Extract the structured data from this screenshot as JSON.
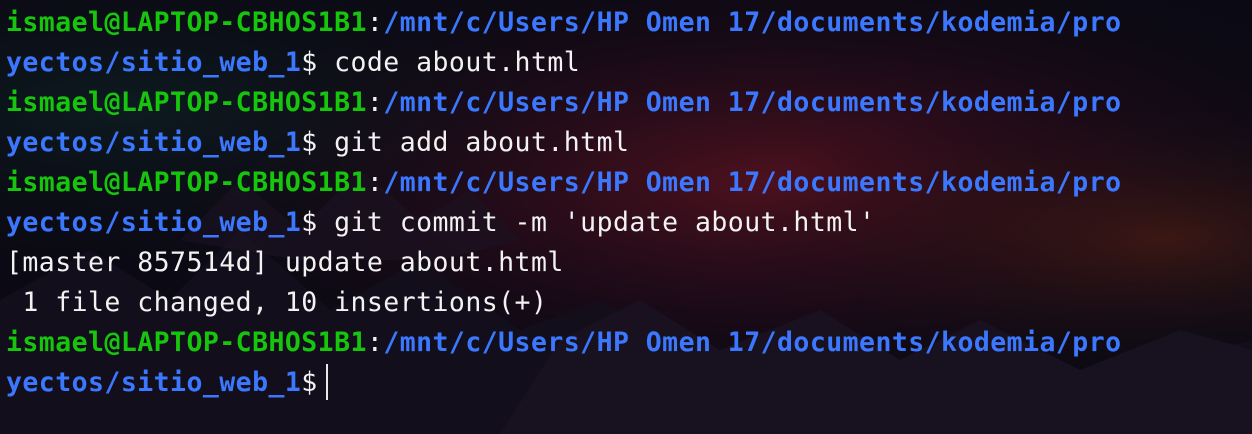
{
  "theme": {
    "background": "#0b0a14",
    "user_host_color": "#16c60c",
    "path_color": "#3b78ff",
    "text_color": "#f2f2f2"
  },
  "prompt": {
    "user_host": "ismael@LAPTOP-CBHOS1B1",
    "separator": ":",
    "path_part1": "/mnt/c/Users/HP Omen 17/documents/kodemia/pro",
    "path_part2": "yectos/sitio_web_1",
    "symbol": "$"
  },
  "session": [
    {
      "type": "command",
      "text": "code about.html"
    },
    {
      "type": "command",
      "text": "git add about.html"
    },
    {
      "type": "command",
      "text": "git commit -m 'update about.html'"
    },
    {
      "type": "output",
      "text": "[master 857514d] update about.html"
    },
    {
      "type": "output",
      "text": " 1 file changed, 10 insertions(+)"
    },
    {
      "type": "active_prompt",
      "text": ""
    }
  ]
}
